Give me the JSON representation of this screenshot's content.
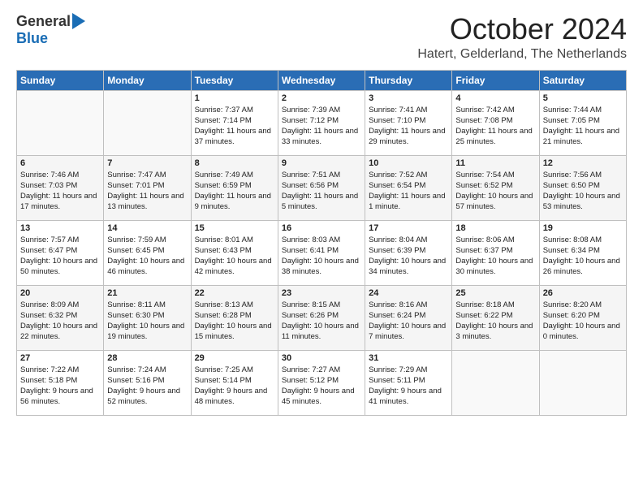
{
  "logo": {
    "general": "General",
    "blue": "Blue"
  },
  "title": {
    "month": "October 2024",
    "location": "Hatert, Gelderland, The Netherlands"
  },
  "headers": [
    "Sunday",
    "Monday",
    "Tuesday",
    "Wednesday",
    "Thursday",
    "Friday",
    "Saturday"
  ],
  "weeks": [
    [
      {
        "day": "",
        "content": ""
      },
      {
        "day": "",
        "content": ""
      },
      {
        "day": "1",
        "content": "Sunrise: 7:37 AM\nSunset: 7:14 PM\nDaylight: 11 hours and 37 minutes."
      },
      {
        "day": "2",
        "content": "Sunrise: 7:39 AM\nSunset: 7:12 PM\nDaylight: 11 hours and 33 minutes."
      },
      {
        "day": "3",
        "content": "Sunrise: 7:41 AM\nSunset: 7:10 PM\nDaylight: 11 hours and 29 minutes."
      },
      {
        "day": "4",
        "content": "Sunrise: 7:42 AM\nSunset: 7:08 PM\nDaylight: 11 hours and 25 minutes."
      },
      {
        "day": "5",
        "content": "Sunrise: 7:44 AM\nSunset: 7:05 PM\nDaylight: 11 hours and 21 minutes."
      }
    ],
    [
      {
        "day": "6",
        "content": "Sunrise: 7:46 AM\nSunset: 7:03 PM\nDaylight: 11 hours and 17 minutes."
      },
      {
        "day": "7",
        "content": "Sunrise: 7:47 AM\nSunset: 7:01 PM\nDaylight: 11 hours and 13 minutes."
      },
      {
        "day": "8",
        "content": "Sunrise: 7:49 AM\nSunset: 6:59 PM\nDaylight: 11 hours and 9 minutes."
      },
      {
        "day": "9",
        "content": "Sunrise: 7:51 AM\nSunset: 6:56 PM\nDaylight: 11 hours and 5 minutes."
      },
      {
        "day": "10",
        "content": "Sunrise: 7:52 AM\nSunset: 6:54 PM\nDaylight: 11 hours and 1 minute."
      },
      {
        "day": "11",
        "content": "Sunrise: 7:54 AM\nSunset: 6:52 PM\nDaylight: 10 hours and 57 minutes."
      },
      {
        "day": "12",
        "content": "Sunrise: 7:56 AM\nSunset: 6:50 PM\nDaylight: 10 hours and 53 minutes."
      }
    ],
    [
      {
        "day": "13",
        "content": "Sunrise: 7:57 AM\nSunset: 6:47 PM\nDaylight: 10 hours and 50 minutes."
      },
      {
        "day": "14",
        "content": "Sunrise: 7:59 AM\nSunset: 6:45 PM\nDaylight: 10 hours and 46 minutes."
      },
      {
        "day": "15",
        "content": "Sunrise: 8:01 AM\nSunset: 6:43 PM\nDaylight: 10 hours and 42 minutes."
      },
      {
        "day": "16",
        "content": "Sunrise: 8:03 AM\nSunset: 6:41 PM\nDaylight: 10 hours and 38 minutes."
      },
      {
        "day": "17",
        "content": "Sunrise: 8:04 AM\nSunset: 6:39 PM\nDaylight: 10 hours and 34 minutes."
      },
      {
        "day": "18",
        "content": "Sunrise: 8:06 AM\nSunset: 6:37 PM\nDaylight: 10 hours and 30 minutes."
      },
      {
        "day": "19",
        "content": "Sunrise: 8:08 AM\nSunset: 6:34 PM\nDaylight: 10 hours and 26 minutes."
      }
    ],
    [
      {
        "day": "20",
        "content": "Sunrise: 8:09 AM\nSunset: 6:32 PM\nDaylight: 10 hours and 22 minutes."
      },
      {
        "day": "21",
        "content": "Sunrise: 8:11 AM\nSunset: 6:30 PM\nDaylight: 10 hours and 19 minutes."
      },
      {
        "day": "22",
        "content": "Sunrise: 8:13 AM\nSunset: 6:28 PM\nDaylight: 10 hours and 15 minutes."
      },
      {
        "day": "23",
        "content": "Sunrise: 8:15 AM\nSunset: 6:26 PM\nDaylight: 10 hours and 11 minutes."
      },
      {
        "day": "24",
        "content": "Sunrise: 8:16 AM\nSunset: 6:24 PM\nDaylight: 10 hours and 7 minutes."
      },
      {
        "day": "25",
        "content": "Sunrise: 8:18 AM\nSunset: 6:22 PM\nDaylight: 10 hours and 3 minutes."
      },
      {
        "day": "26",
        "content": "Sunrise: 8:20 AM\nSunset: 6:20 PM\nDaylight: 10 hours and 0 minutes."
      }
    ],
    [
      {
        "day": "27",
        "content": "Sunrise: 7:22 AM\nSunset: 5:18 PM\nDaylight: 9 hours and 56 minutes."
      },
      {
        "day": "28",
        "content": "Sunrise: 7:24 AM\nSunset: 5:16 PM\nDaylight: 9 hours and 52 minutes."
      },
      {
        "day": "29",
        "content": "Sunrise: 7:25 AM\nSunset: 5:14 PM\nDaylight: 9 hours and 48 minutes."
      },
      {
        "day": "30",
        "content": "Sunrise: 7:27 AM\nSunset: 5:12 PM\nDaylight: 9 hours and 45 minutes."
      },
      {
        "day": "31",
        "content": "Sunrise: 7:29 AM\nSunset: 5:11 PM\nDaylight: 9 hours and 41 minutes."
      },
      {
        "day": "",
        "content": ""
      },
      {
        "day": "",
        "content": ""
      }
    ]
  ]
}
